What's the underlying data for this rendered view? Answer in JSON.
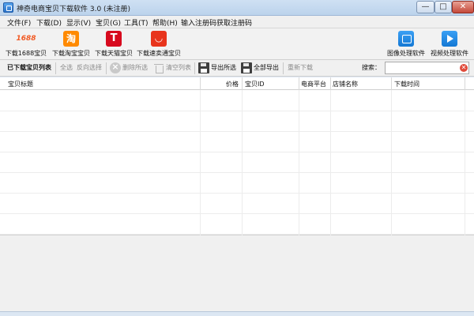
{
  "window": {
    "title": "神奇电商宝贝下载软件 3.0 (未注册)",
    "min": "—",
    "max": "□",
    "close": "✕"
  },
  "menu": [
    "文件(F)",
    "下载(D)",
    "显示(V)",
    "宝贝(G)",
    "工具(T)",
    "帮助(H)",
    "输入注册码",
    "获取注册码"
  ],
  "toolbar": {
    "tools": [
      {
        "label": "下载1688宝贝",
        "icon": "1688-icon",
        "glyph": "1688"
      },
      {
        "label": "下载淘宝宝贝",
        "icon": "taobao-icon",
        "glyph": "淘"
      },
      {
        "label": "下载天猫宝贝",
        "icon": "tmall-icon",
        "glyph": "T"
      },
      {
        "label": "下载速卖通宝贝",
        "icon": "aliexpress-icon",
        "glyph": "◡"
      },
      {
        "label": "图像处理软件",
        "icon": "image-tool-icon",
        "glyph": ""
      },
      {
        "label": "视频处理软件",
        "icon": "video-tool-icon",
        "glyph": ""
      }
    ]
  },
  "actions": {
    "list_label": "已下载宝贝列表",
    "select_all": "全选",
    "invert_select": "反向选择",
    "delete_selected": "删除所选",
    "clear_list": "清空列表",
    "export_selected": "导出所选",
    "export_all": "全部导出",
    "redownload": "重新下载",
    "search_label": "搜索：",
    "search_value": ""
  },
  "table": {
    "columns": [
      "宝贝标题",
      "价格",
      "宝贝ID",
      "电商平台",
      "店铺名称",
      "下载时间"
    ],
    "rows": []
  },
  "colors": {
    "titlebar": "#c6daf0",
    "close": "#c4483a",
    "taobao": "#ff8a00",
    "tmall": "#d70a1e",
    "aliexpress": "#e8341c",
    "tool_blue": "#1c88e4"
  }
}
